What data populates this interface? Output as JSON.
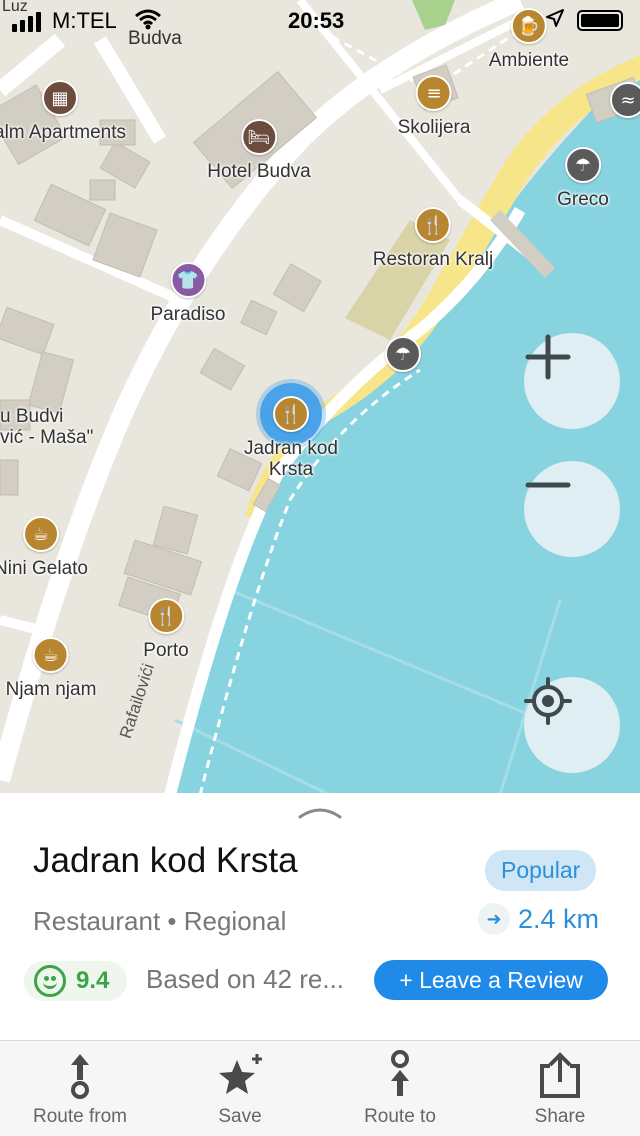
{
  "status_bar": {
    "carrier": "M:TEL",
    "time": "20:53",
    "corner_label": "Luz",
    "city_label": "Budva"
  },
  "map": {
    "pois": [
      {
        "label": "Ambiente",
        "icon": "beer-icon"
      },
      {
        "label": "Skolijera",
        "icon": "burger-icon"
      },
      {
        "label": "Greco",
        "icon": "beach-umbrella-icon"
      },
      {
        "label": "alm Apartments",
        "icon": "apartment-icon"
      },
      {
        "label": "Hotel Budva",
        "icon": "bed-icon"
      },
      {
        "label": "Restoran Kralj",
        "icon": "restaurant-icon"
      },
      {
        "label": "Paradiso",
        "icon": "shirt-icon"
      },
      {
        "label": "Jadran kod Krsta",
        "icon": "restaurant-icon"
      },
      {
        "label": "u Budvi\nvić - Maša\"",
        "icon": "none"
      },
      {
        "label": "Nini Gelato",
        "icon": "coffee-icon"
      },
      {
        "label": "Porto",
        "icon": "restaurant-icon"
      },
      {
        "label": "Njam njam",
        "icon": "coffee-icon"
      }
    ],
    "street_label": "Rafailovići",
    "colors": {
      "land": "#e9e6dd",
      "water": "#88d3e0",
      "beach": "#f7e689",
      "building": "#d3cec4",
      "road": "#ffffff",
      "food_poi": "#b7862f",
      "selected": "#4aa3e8"
    }
  },
  "controls": {
    "zoom_in": "+",
    "zoom_out": "−"
  },
  "place": {
    "name": "Jadran kod Krsta",
    "badge": "Popular",
    "category": "Restaurant • Regional",
    "distance": "2.4 km",
    "rating": "9.4",
    "reviews_text": "Based on 42 re...",
    "review_button": "+ Leave a Review"
  },
  "tabs": [
    {
      "label": "Route from",
      "icon": "route-from-icon"
    },
    {
      "label": "Save",
      "icon": "star-add-icon"
    },
    {
      "label": "Route to",
      "icon": "route-to-icon"
    },
    {
      "label": "Share",
      "icon": "share-icon"
    }
  ]
}
